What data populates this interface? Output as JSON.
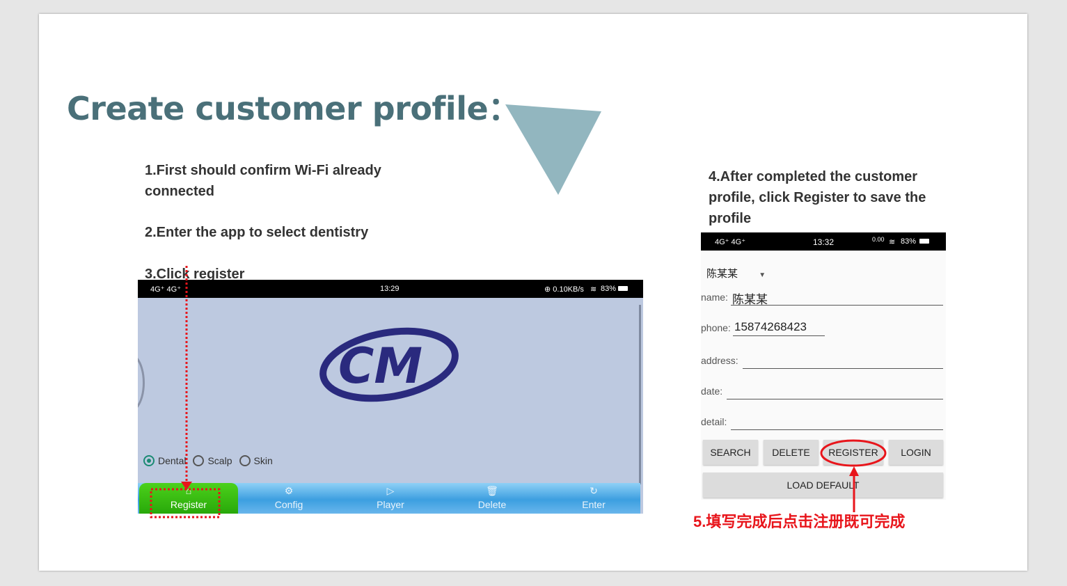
{
  "slide": {
    "title": "Create customer profile：",
    "step1_line1": "1.First should confirm Wi-Fi  already",
    "step1_line2": "connected",
    "step2": "2.Enter the app to select dentistry",
    "step3": "3.Click  register",
    "step4_line1": "4.After completed the customer",
    "step4_line2": "profile, click Register to save the",
    "step4_line3": "profile",
    "caption": "5.填写完成后点击注册既可完成"
  },
  "left_app": {
    "status": {
      "signal": "4G⁺ 4G⁺",
      "time": "13:29",
      "net": "⊕ 0.10KB/s",
      "battery": "83%"
    },
    "logo_text": "CM",
    "modes": [
      {
        "label": "Dental",
        "selected": true
      },
      {
        "label": "Scalp",
        "selected": false
      },
      {
        "label": "Skin",
        "selected": false
      }
    ],
    "tabs": [
      {
        "label": "Register",
        "icon": "⌂"
      },
      {
        "label": "Config",
        "icon": "⚙"
      },
      {
        "label": "Player",
        "icon": "▷"
      },
      {
        "label": "Delete",
        "icon": "🗑"
      },
      {
        "label": "Enter",
        "icon": "↻"
      }
    ],
    "colors": {
      "bg": "#bdc9e0",
      "logo": "#2a2a7e",
      "register_tab": "#3fbf12",
      "bar": "#4aa8e6"
    }
  },
  "right_app": {
    "status": {
      "signal": "4G⁺ 4G⁺",
      "time": "13:32",
      "net": "0.00",
      "battery": "83%"
    },
    "dropdown": "陈某某",
    "fields": {
      "name_label": "name:",
      "name_value": "陈某某",
      "phone_label": "phone:",
      "phone_value": "15874268423",
      "address_label": "address:",
      "date_label": "date:",
      "detail_label": "detail:"
    },
    "buttons": {
      "search": "SEARCH",
      "delete": "DELETE",
      "register": "REGISTER",
      "login": "LOGIN",
      "load_default": "LOAD DEFAULT"
    }
  },
  "colors": {
    "title": "#4a7079",
    "triangle": "#92b6bf",
    "annotation": "#e8151b"
  }
}
